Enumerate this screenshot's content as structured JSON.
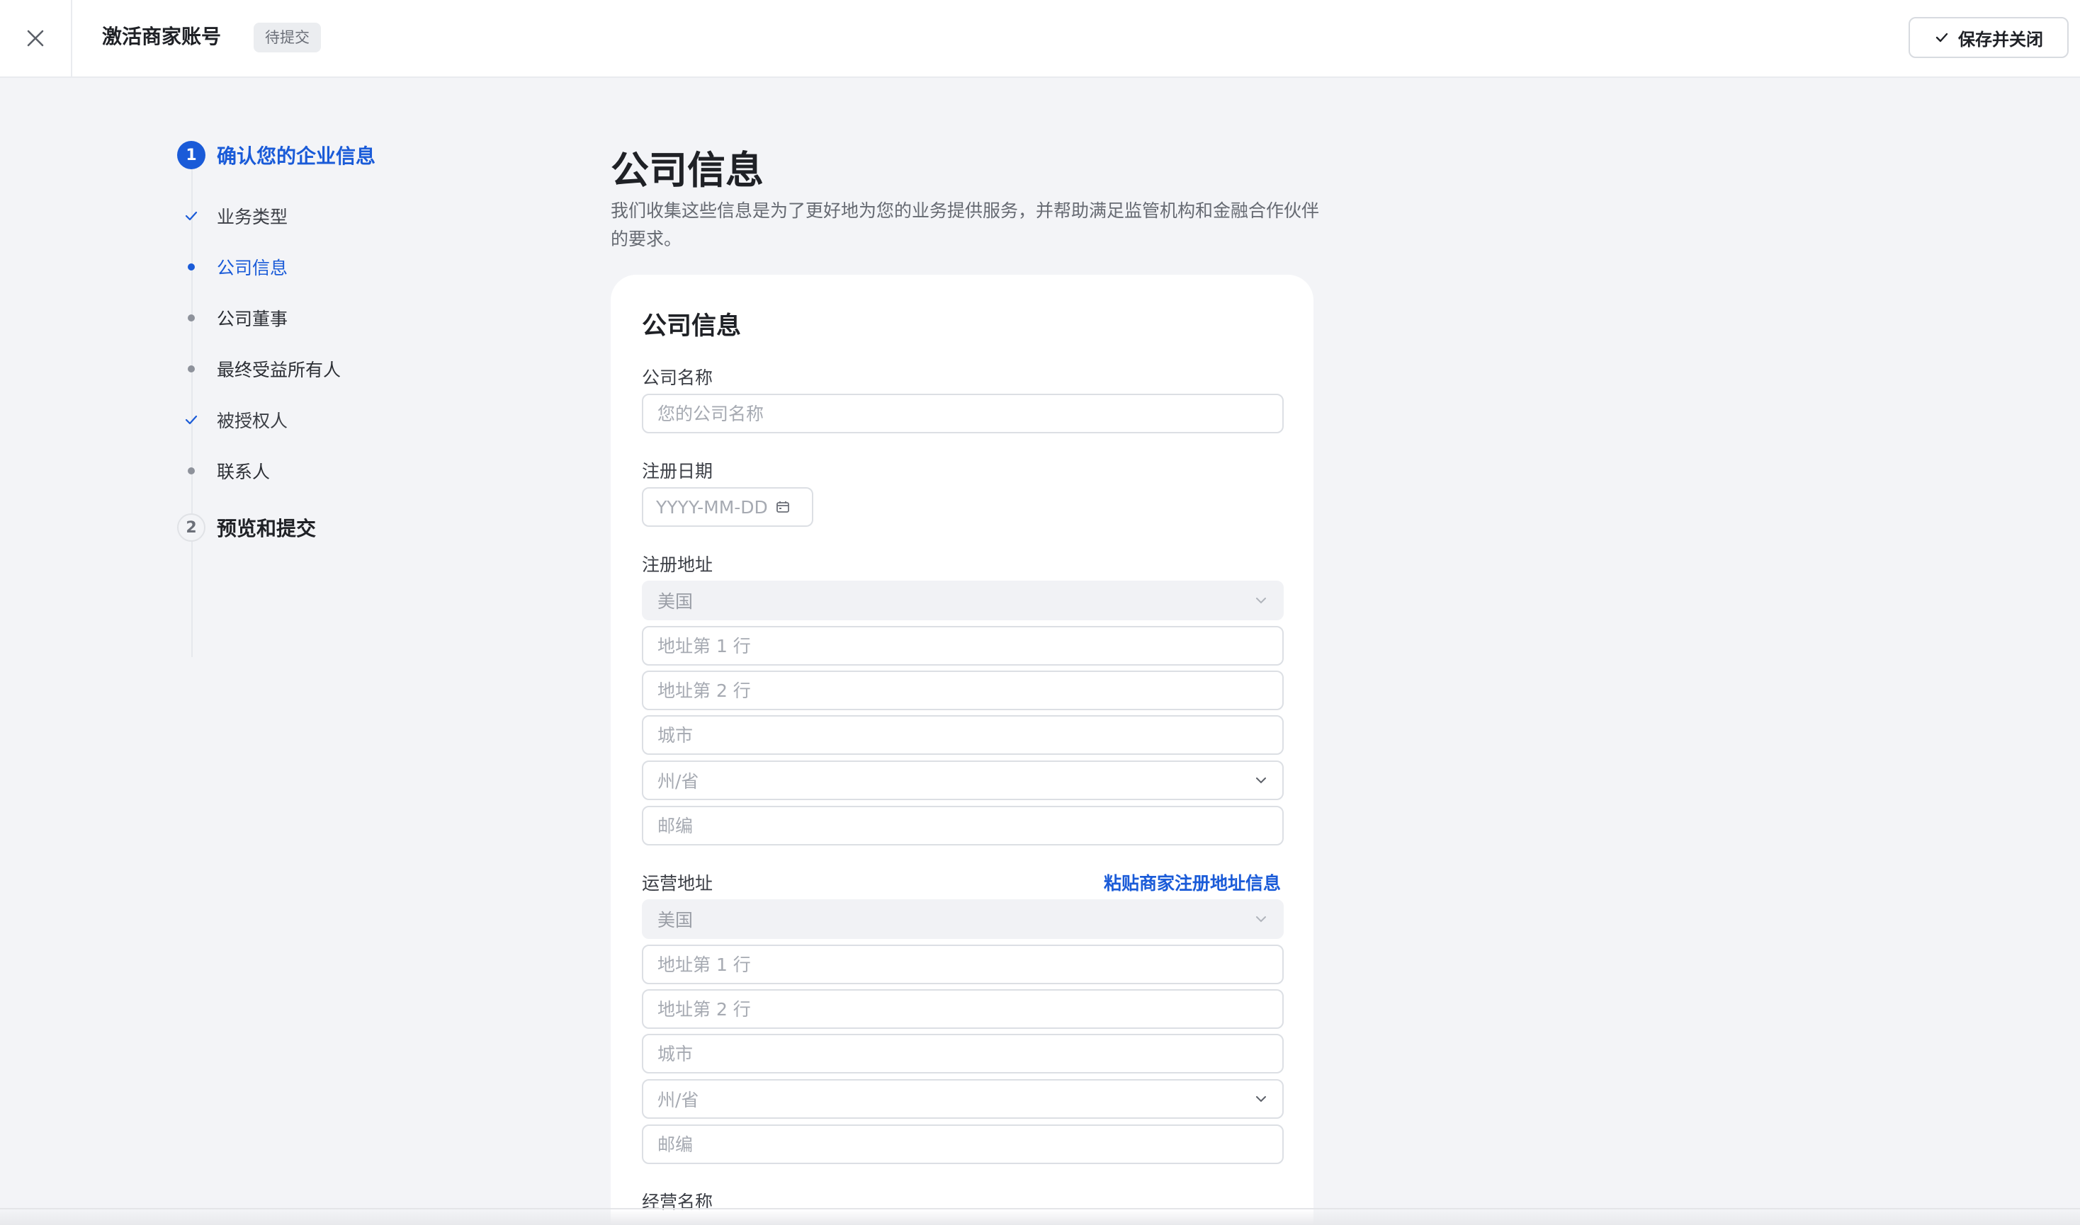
{
  "header": {
    "title": "激活商家账号",
    "status_badge": "待提交",
    "save_close_label": "保存并关闭"
  },
  "stepper": {
    "steps": [
      {
        "number": "1",
        "label": "确认您的企业信息",
        "state": "active",
        "substeps": [
          {
            "label": "业务类型",
            "state": "done"
          },
          {
            "label": "公司信息",
            "state": "current"
          },
          {
            "label": "公司董事",
            "state": "pending"
          },
          {
            "label": "最终受益所有人",
            "state": "pending"
          },
          {
            "label": "被授权人",
            "state": "done"
          },
          {
            "label": "联系人",
            "state": "pending"
          }
        ]
      },
      {
        "number": "2",
        "label": "预览和提交",
        "state": "idle"
      }
    ]
  },
  "main": {
    "title": "公司信息",
    "description": "我们收集这些信息是为了更好地为您的业务提供服务，并帮助满足监管机构和金融合作伙伴的要求。"
  },
  "card": {
    "title": "公司信息",
    "company_name": {
      "label": "公司名称",
      "placeholder": "您的公司名称",
      "value": ""
    },
    "registration_date": {
      "label": "注册日期",
      "placeholder": "YYYY-MM-DD"
    },
    "registered_address": {
      "label": "注册地址",
      "country": "美国",
      "line1_placeholder": "地址第 1 行",
      "line2_placeholder": "地址第 2 行",
      "city_placeholder": "城市",
      "state_placeholder": "州/省",
      "zip_placeholder": "邮编"
    },
    "operating_address": {
      "label": "运营地址",
      "paste_link": "粘贴商家注册地址信息",
      "country": "美国",
      "line1_placeholder": "地址第 1 行",
      "line2_placeholder": "地址第 2 行",
      "city_placeholder": "城市",
      "state_placeholder": "州/省",
      "zip_placeholder": "邮编"
    },
    "business_name_label": "经营名称"
  },
  "colors": {
    "accent": "#1a5bd8",
    "page_bg": "#f3f4f7"
  }
}
